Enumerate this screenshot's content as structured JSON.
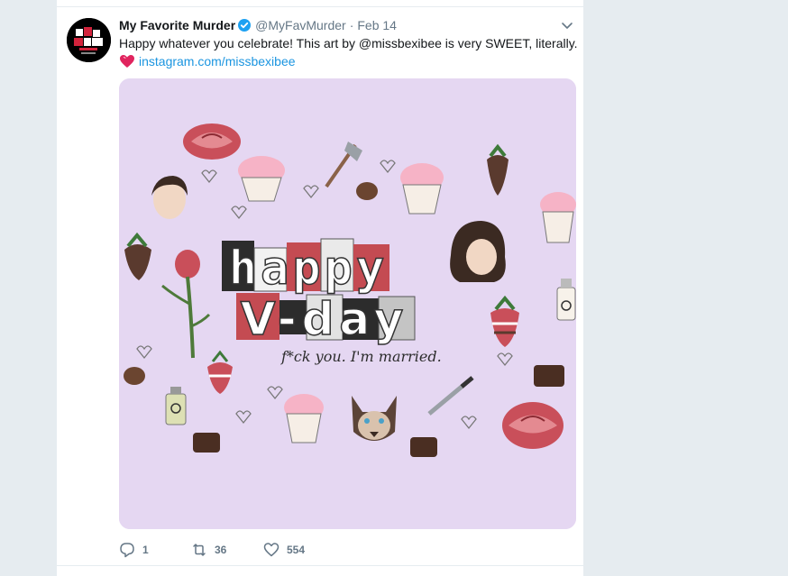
{
  "tweet": {
    "display_name": "My Favorite Murder",
    "handle": "@MyFavMurder",
    "separator": "·",
    "timestamp": "Feb 14",
    "text": "Happy whatever you celebrate! This art by @missbexibee is very SWEET, literally.",
    "link_text": "instagram.com/missbexibee",
    "avatar_text": "my favorite murder",
    "verified": true
  },
  "artwork": {
    "headline_top": "happy",
    "headline_bottom": "V-day",
    "tagline": "f*ck you. I'm married."
  },
  "actions": {
    "reply_count": "1",
    "retweet_count": "36",
    "like_count": "554"
  },
  "colors": {
    "link": "#1b95e0",
    "verified": "#1da1f2",
    "media_background": "#e5d7f2",
    "muted": "#657786"
  }
}
